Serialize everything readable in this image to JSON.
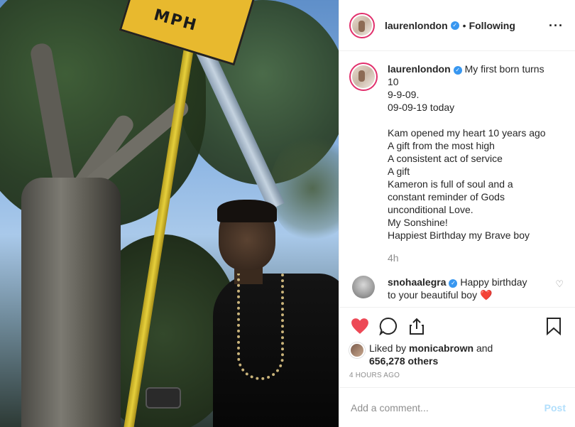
{
  "photo": {
    "sign_text": "MPH"
  },
  "header": {
    "username": "laurenlondon",
    "separator": "•",
    "follow_status": "Following",
    "more_icon": "more-options-icon"
  },
  "caption": {
    "username": "laurenlondon",
    "lines": [
      "My first born turns",
      "10",
      "9-9-09.",
      "09-09-19 today",
      "",
      "Kam opened my heart 10 years ago",
      "A gift from the most high",
      "A consistent act of service",
      "A gift",
      "Kameron is full of soul and a",
      "constant reminder of Gods",
      "unconditional Love.",
      "My Sonshine!",
      "Happiest Birthday my Brave boy"
    ],
    "time": "4h"
  },
  "comment": {
    "username": "snohaalegra",
    "text_line1": "Happy birthday",
    "text_line2": "to your beautiful boy",
    "emoji": "❤️"
  },
  "actions": {
    "like_icon": "heart-filled-icon",
    "comment_icon": "comment-bubble-icon",
    "share_icon": "share-icon",
    "save_icon": "bookmark-icon",
    "liked_by_prefix": "Liked by",
    "liked_by_user": "monicabrown",
    "liked_by_and": "and",
    "others_count": "656,278 others",
    "post_time": "4 HOURS AGO"
  },
  "add_comment": {
    "placeholder": "Add a comment...",
    "post_label": "Post"
  },
  "colors": {
    "like_red": "#ed4956",
    "verified_blue": "#3897f0",
    "post_disabled": "#b2dffc"
  }
}
